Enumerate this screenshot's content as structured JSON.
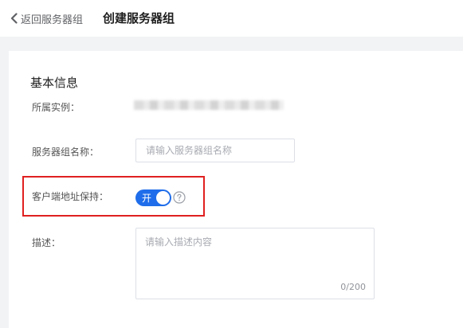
{
  "header": {
    "back_label": "返回服务器组",
    "title": "创建服务器组"
  },
  "form": {
    "section_title": "基本信息",
    "instance_label": "所属实例：",
    "name_label": "服务器组名称：",
    "name_placeholder": "请输入服务器组名称",
    "client_ip_label": "客户端地址保持：",
    "client_ip_switch_text": "开",
    "desc_label": "描述：",
    "desc_placeholder": "请输入描述内容",
    "desc_counter": "0/200"
  },
  "colors": {
    "accent": "#1f6dea",
    "highlight": "#e02020"
  }
}
